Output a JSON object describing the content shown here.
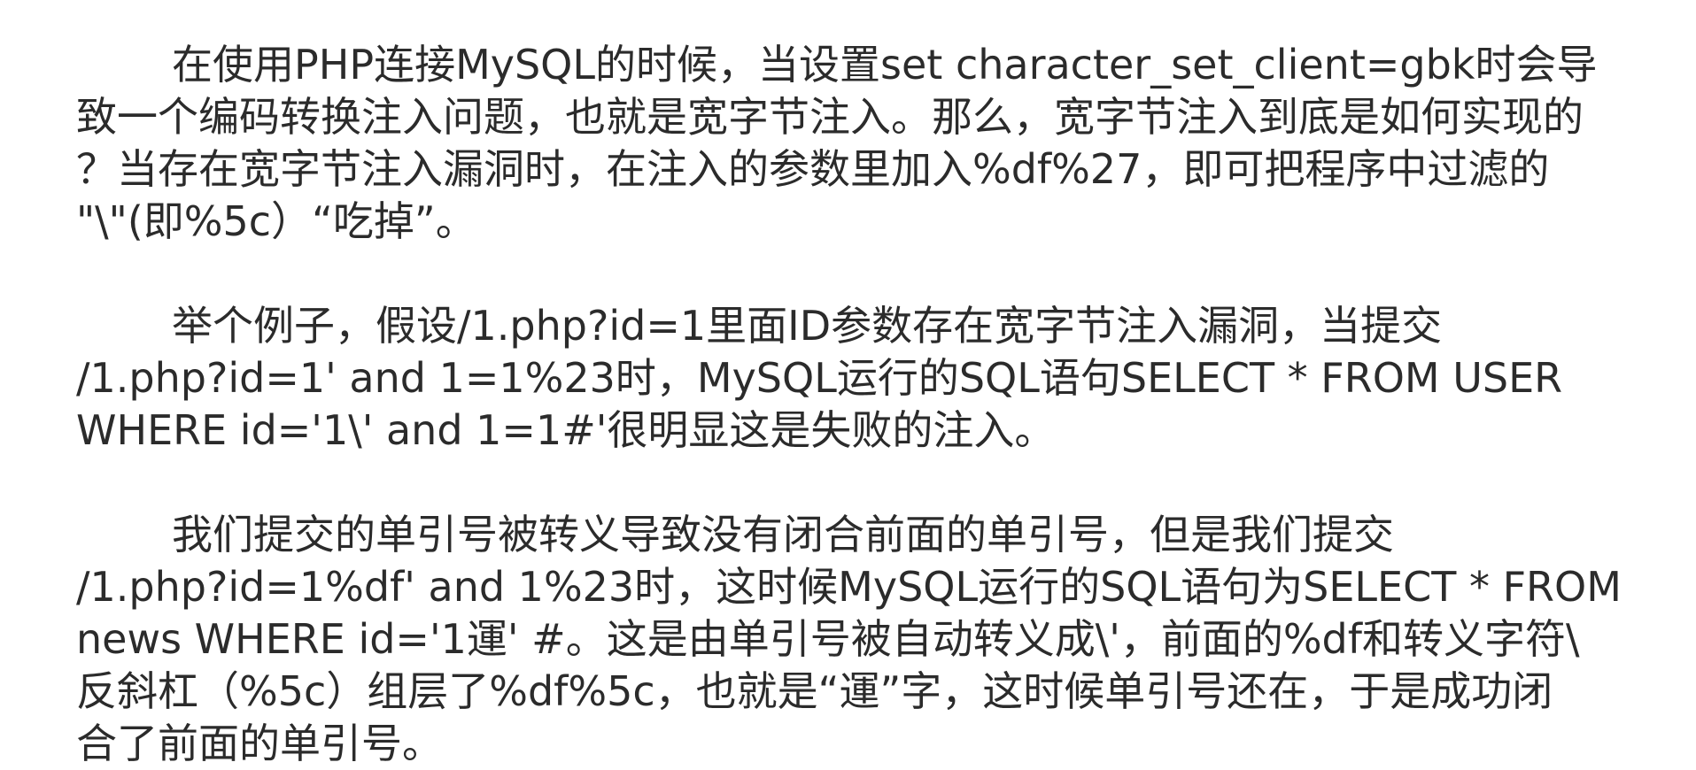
{
  "paragraphs": [
    {
      "lines": [
        "在使用PHP连接MySQL的时候，当设置set character_set_client=gbk时会导",
        "致一个编码转换注入问题，也就是宽字节注入。那么，宽字节注入到底是如何实现的",
        "？当存在宽字节注入漏洞时，在注入的参数里加入%df%27，即可把程序中过滤的",
        "\"\\\"(即%5c）“吃掉”。"
      ]
    },
    {
      "lines": [
        "举个例子，假设/1.php?id=1里面ID参数存在宽字节注入漏洞，当提交",
        "/1.php?id=1' and 1=1%23时，MySQL运行的SQL语句SELECT * FROM USER",
        "WHERE id='1\\' and 1=1#'很明显这是失败的注入。"
      ]
    },
    {
      "lines": [
        "我们提交的单引号被转义导致没有闭合前面的单引号，但是我们提交",
        "/1.php?id=1%df' and 1%23时，这时候MySQL运行的SQL语句为SELECT * FROM",
        "news WHERE id='1運' #。这是由单引号被自动转义成\\'，前面的%df和转义字符\\",
        "反斜杠（%5c）组层了%df%5c，也就是“運”字，这时候单引号还在，于是成功闭",
        "合了前面的单引号。"
      ]
    }
  ]
}
